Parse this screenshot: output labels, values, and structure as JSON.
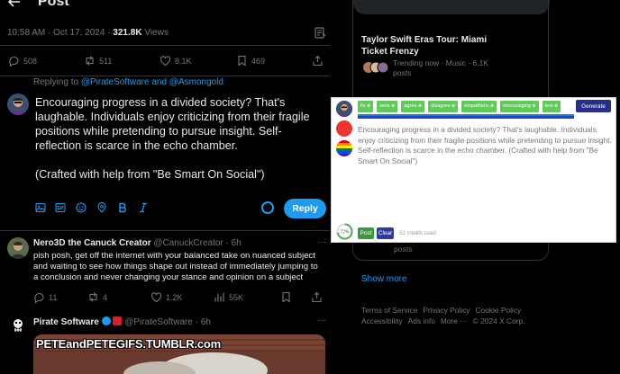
{
  "header": {
    "title": "Post"
  },
  "meta": {
    "time_date": "10:58 AM · Oct 17, 2024 · ",
    "views_count": "321.8K",
    "views_label": " Views"
  },
  "actions": {
    "replies": "508",
    "reposts": "511",
    "likes": "8.1K",
    "bookmarks": "469"
  },
  "replying": {
    "prefix": "Replying to ",
    "handles": "@PirateSoftware and @Asmongold"
  },
  "compose": {
    "lines": [
      "Encouraging progress in a divided society? That's laughable. Individuals enjoy criticizing from their fragile positions while pretending to pursue insight. Self-reflection is scarce in the echo chamber.",
      "(Crafted with help from \"Be Smart On Social\")"
    ],
    "reply_label": "Reply",
    "tools": [
      "image-icon",
      "gif-icon",
      "emoji-icon",
      "location-icon",
      "bold-icon",
      "italic-icon"
    ]
  },
  "tweets": [
    {
      "name": "Nero3D the Canuck Creator",
      "handle": " @CanuckCreator · 6h",
      "body": "pish posh, get off the internet with your balanced take on nuanced subject and waiting to see how things shape out instead of immediately jumping to a conclusion and never changing your stance and opinion on a subject",
      "replies": "11",
      "reposts": "4",
      "likes": "1.2K",
      "views": "55K"
    },
    {
      "name": "Pirate Software",
      "handle": " @PirateSoftware · 6h",
      "gif_caption": "PETEandPETEGIFS.TUMBLR.com"
    }
  ],
  "sidebar": {
    "trend_title": "Taylor Swift Eras Tour: Miami Ticket Frenzy",
    "trend_meta": "Trending now · Music · 6.1K posts",
    "trend_posts_2": "posts",
    "show_more": "Show more",
    "footer": [
      "Terms of Service",
      "Privacy Policy",
      "Cookie Policy",
      "Accessibility",
      "Ads info",
      "More ···",
      "© 2024 X Corp."
    ]
  },
  "overlay": {
    "tags": [
      "fix",
      "sexx",
      "agree",
      "disagree",
      "empathetic",
      "encouraging",
      "text"
    ],
    "generate_label": "Generate",
    "text": "Encouraging progress in a divided society? That's laughable. Individuals enjoy criticizing from their fragile positions while pretending to pursue insight. Self-reflection is scarce in the echo chamber. (Crafted with help from \"Be Smart On Social\")",
    "progress_label": "72%",
    "progress_value": 0.72,
    "post_label": "Post",
    "clear_label": "Clear",
    "credits": "51 credits used"
  },
  "colors": {
    "accent": "#1d9bf0",
    "tag_green": "#5fcb57",
    "generate_navy": "#262f8a"
  }
}
